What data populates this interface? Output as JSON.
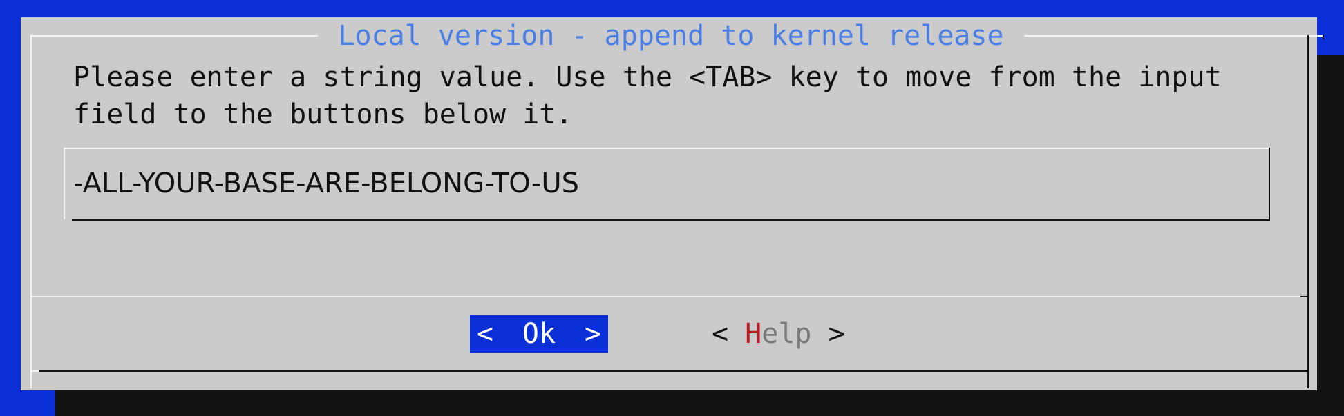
{
  "dialog": {
    "title": "Local version - append to kernel release",
    "prompt": "Please enter a string value. Use the <TAB> key to move from the input\nfield to the buttons below it.",
    "input_value": "-ALL-YOUR-BASE-ARE-BELONG-TO-US"
  },
  "buttons": {
    "ok": {
      "left_bracket": "<",
      "label": "Ok",
      "right_bracket": ">"
    },
    "help": {
      "left_bracket": "< ",
      "hotkey": "H",
      "rest": "elp",
      "right_bracket": " >"
    }
  },
  "colors": {
    "background": "#0a2fd6",
    "dialog": "#cbcbcb",
    "title": "#4c7fe6",
    "selected_button": "#0a2fd6",
    "hotkey": "#c01c28",
    "disabled_text": "#7a7a7a"
  }
}
